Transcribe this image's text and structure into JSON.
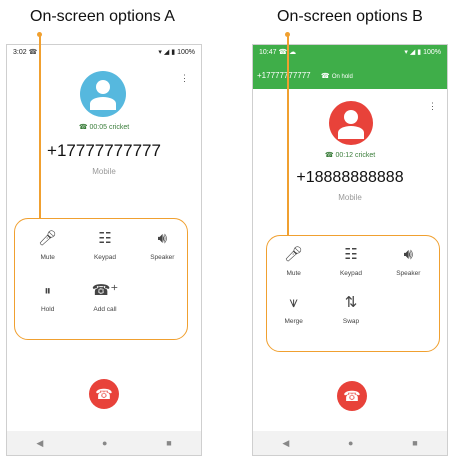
{
  "captions": {
    "a": "On-screen options A",
    "b": "On-screen options B"
  },
  "colors": {
    "highlight": "#f0a030",
    "green": "#3fae49",
    "end_call": "#e8423a",
    "avatar_a": "#56b8de",
    "avatar_b": "#e8423a"
  },
  "phone_a": {
    "status_time": "3:02",
    "status_battery": "100%",
    "call_duration": "00:05 cricket",
    "number": "+17777777777",
    "number_type": "Mobile",
    "options": [
      {
        "label": "Mute",
        "icon": "mic-off-icon"
      },
      {
        "label": "Keypad",
        "icon": "dialpad-icon"
      },
      {
        "label": "Speaker",
        "icon": "speaker-icon"
      },
      {
        "label": "Hold",
        "icon": "pause-icon"
      },
      {
        "label": "Add call",
        "icon": "add-call-icon"
      }
    ]
  },
  "phone_b": {
    "status_time": "10:47",
    "status_battery": "100%",
    "held_number": "+17777777777",
    "held_status": "On hold",
    "call_duration": "00:12 cricket",
    "number": "+18888888888",
    "number_type": "Mobile",
    "options": [
      {
        "label": "Mute",
        "icon": "mic-off-icon"
      },
      {
        "label": "Keypad",
        "icon": "dialpad-icon"
      },
      {
        "label": "Speaker",
        "icon": "speaker-icon"
      },
      {
        "label": "Merge",
        "icon": "merge-icon"
      },
      {
        "label": "Swap",
        "icon": "swap-icon"
      }
    ]
  }
}
